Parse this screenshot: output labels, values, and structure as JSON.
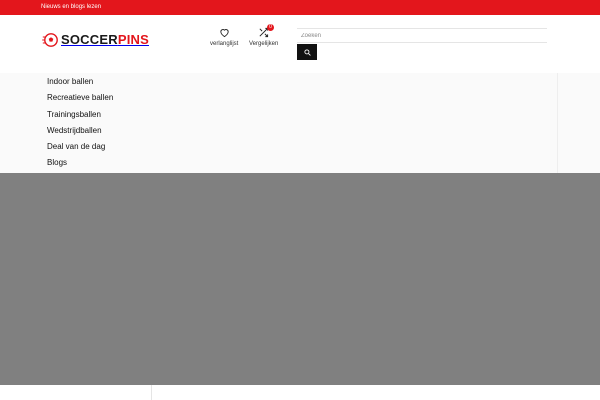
{
  "topbar": {
    "link_text": "Nieuws en blogs lezen",
    "color": "#e3161c"
  },
  "logo": {
    "text_main": "SOCCER",
    "text_accent": "PINS",
    "icon": "soccer-ball-icon"
  },
  "header": {
    "wishlist_label": "verlanglijst",
    "wishlist_icon": "heart-icon",
    "compare_label": "Vergelijken",
    "compare_icon": "shuffle-icon",
    "compare_count": "0",
    "search_placeholder": "Zoeken",
    "search_icon": "search-icon"
  },
  "nav": {
    "items": [
      {
        "label": "Indoor ballen"
      },
      {
        "label": "Recreatieve ballen"
      },
      {
        "label": "Trainingsballen"
      },
      {
        "label": "Wedstrijdballen"
      },
      {
        "label": "Deal van de dag"
      },
      {
        "label": "Blogs"
      }
    ]
  },
  "colors": {
    "accent": "#e3161c",
    "banner": "#808080",
    "button": "#111111"
  }
}
